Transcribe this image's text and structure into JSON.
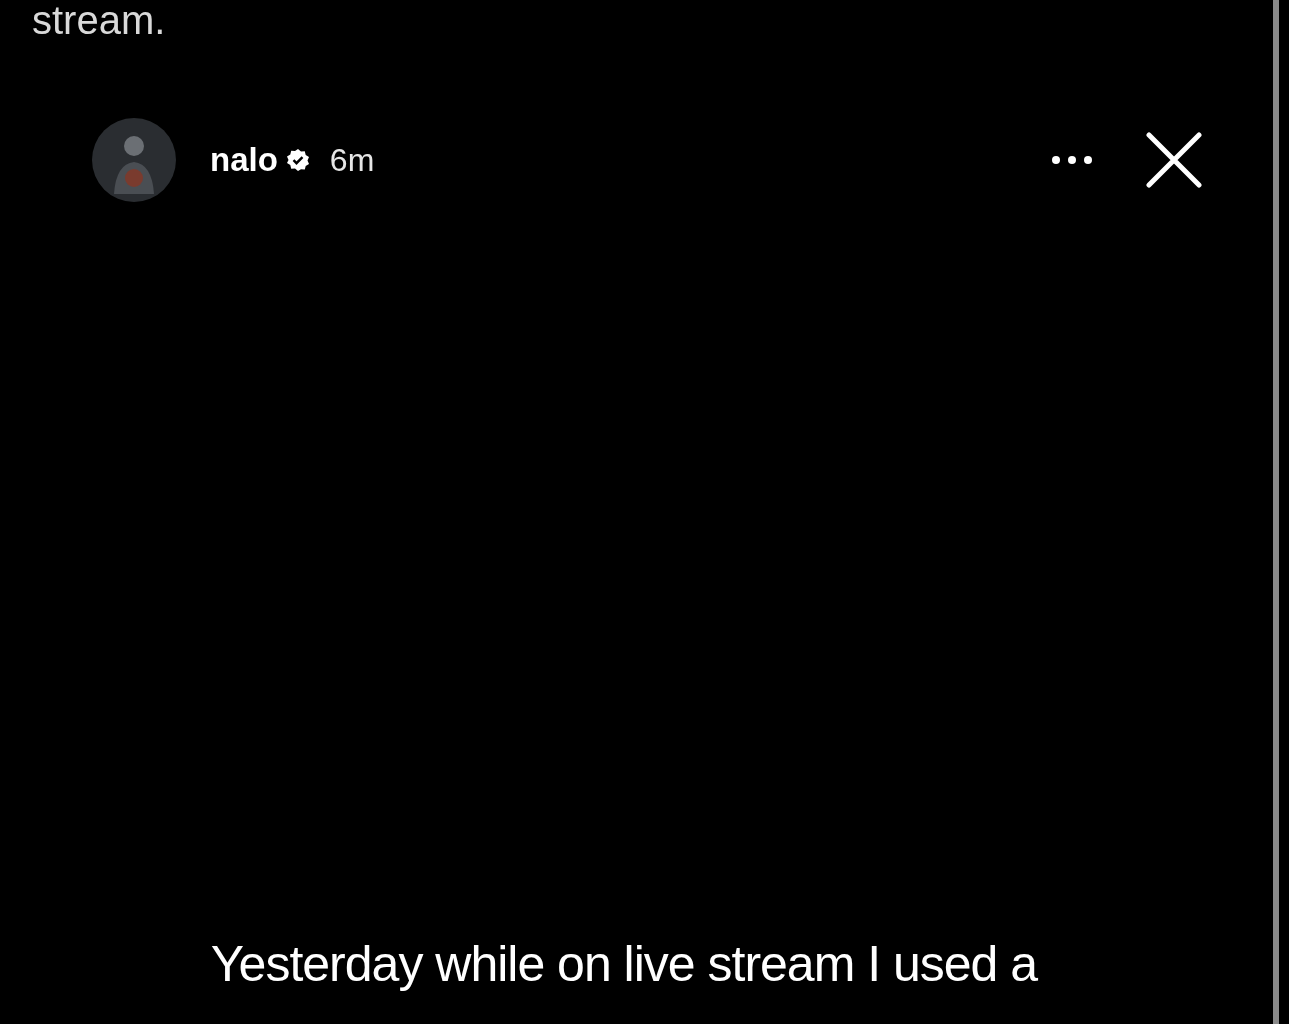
{
  "post_text_tail": "stream.",
  "story": {
    "author": {
      "username": "nalo",
      "verified": true,
      "time": "6m"
    },
    "caption": "Yesterday while on live stream I used a"
  }
}
